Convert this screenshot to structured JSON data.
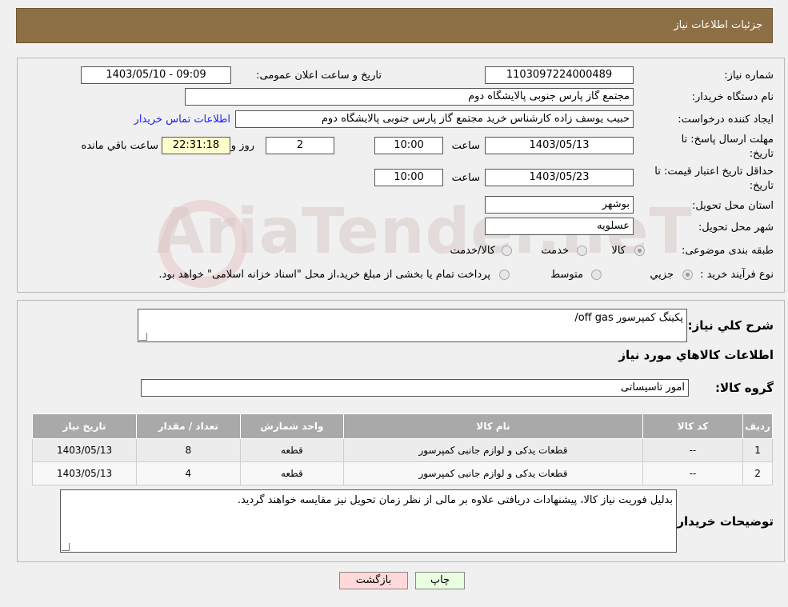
{
  "header": {
    "title": "جزئیات اطلاعات نیاز"
  },
  "form": {
    "need_number_label": "شماره نیاز:",
    "need_number": "1103097224000489",
    "announce_label": "تاریخ و ساعت اعلان عمومی:",
    "announce_value": "1403/05/10 - 09:09",
    "buyer_org_label": "نام دستگاه خریدار:",
    "buyer_org": "مجتمع گاز پارس جنوبی  پالایشگاه دوم",
    "creator_label": "ایجاد کننده درخواست:",
    "creator": "حبیب یوسف زاده کارشناس خرید مجتمع گاز پارس جنوبی  پالایشگاه دوم",
    "contact_link": "اطلاعات تماس خریدار",
    "deadline_label_1": "مهلت ارسال پاسخ: تا",
    "deadline_label_2": "تاریخ:",
    "deadline_date": "1403/05/13",
    "time_label": "ساعت",
    "deadline_time": "10:00",
    "days_value": "2",
    "days_label": "روز و",
    "remaining_time": "22:31:18",
    "remaining_label": "ساعت باقي مانده",
    "validity_label_1": "حداقل تاریخ اعتبار قیمت: تا",
    "validity_label_2": "تاریخ:",
    "validity_date": "1403/05/23",
    "validity_time": "10:00",
    "province_label": "استان محل تحویل:",
    "province": "بوشهر",
    "city_label": "شهر محل تحویل:",
    "city": "عسلویه",
    "category_label": "طبقه بندی موضوعی:",
    "category_options": [
      "کالا",
      "خدمت",
      "کالا/خدمت"
    ],
    "process_label": "نوع فرآیند خرید :",
    "process_options": [
      "جزیي",
      "متوسط"
    ],
    "payment_note": "پرداخت تمام یا بخشی از مبلغ خرید،از محل \"اسناد خزانه اسلامی\" خواهد بود."
  },
  "description": {
    "label": "شرح کلي نياز:",
    "value": "پکینگ کمپرسور off gas/"
  },
  "goods": {
    "section_title": "اطلاعات کالاهاي مورد نياز",
    "group_label": "گروه کالا:",
    "group_value": "امور تاسیساتی",
    "columns": [
      "رديف",
      "کد کالا",
      "نام کالا",
      "واحد شمارش",
      "تعداد / مقدار",
      "تاريخ نياز"
    ],
    "rows": [
      [
        "1",
        "--",
        "قطعات یدکی و لوازم جانبی کمپرسور",
        "قطعه",
        "8",
        "1403/05/13"
      ],
      [
        "2",
        "--",
        "قطعات یدکی و لوازم جانبی کمپرسور",
        "قطعه",
        "4",
        "1403/05/13"
      ]
    ]
  },
  "buyer_notes": {
    "label": "توضیحات خریدار:",
    "value": "بدلیل فوریت نیاز کالا، پیشنهادات دریافتی علاوه بر مالی از نظر زمان تحویل نیز مقایسه خواهند گردید."
  },
  "buttons": {
    "print": "چاپ",
    "back": "بازگشت"
  },
  "watermark": "AriaTender.neT",
  "colors": {
    "header": "#8d6f45",
    "table_header": "#a9a9a9",
    "back_button": "#ffd9d9",
    "print_button": "#e9ffe0",
    "link": "#1a1aff"
  }
}
